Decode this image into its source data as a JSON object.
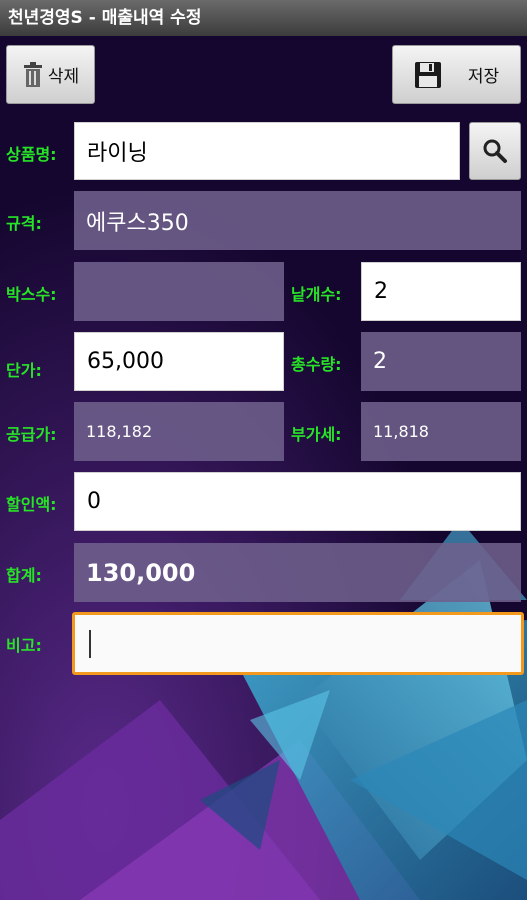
{
  "title": "천년경영S - 매출내역 수정",
  "toolbar": {
    "delete_label": "삭제",
    "save_label": "저장"
  },
  "labels": {
    "product_name": "상품명:",
    "spec": "규격:",
    "box_count": "박스수:",
    "piece_count": "낱개수:",
    "unit_price": "단가:",
    "total_qty": "총수량:",
    "supply_price": "공급가:",
    "vat": "부가세:",
    "discount": "할인액:",
    "total": "합계:",
    "memo": "비고:"
  },
  "values": {
    "product_name": "라이닝",
    "spec": "에쿠스350",
    "box_count": "",
    "piece_count": "2",
    "unit_price": "65,000",
    "total_qty": "2",
    "supply_price": "118,182",
    "vat": "11,818",
    "discount": "0",
    "total": "130,000",
    "memo": ""
  },
  "icons": {
    "delete": "trash-icon",
    "save": "floppy-disk-icon",
    "search": "search-icon"
  },
  "colors": {
    "label_green": "#27e427",
    "focus_orange": "#f39a1e",
    "readonly_purple": "#6e608c"
  }
}
